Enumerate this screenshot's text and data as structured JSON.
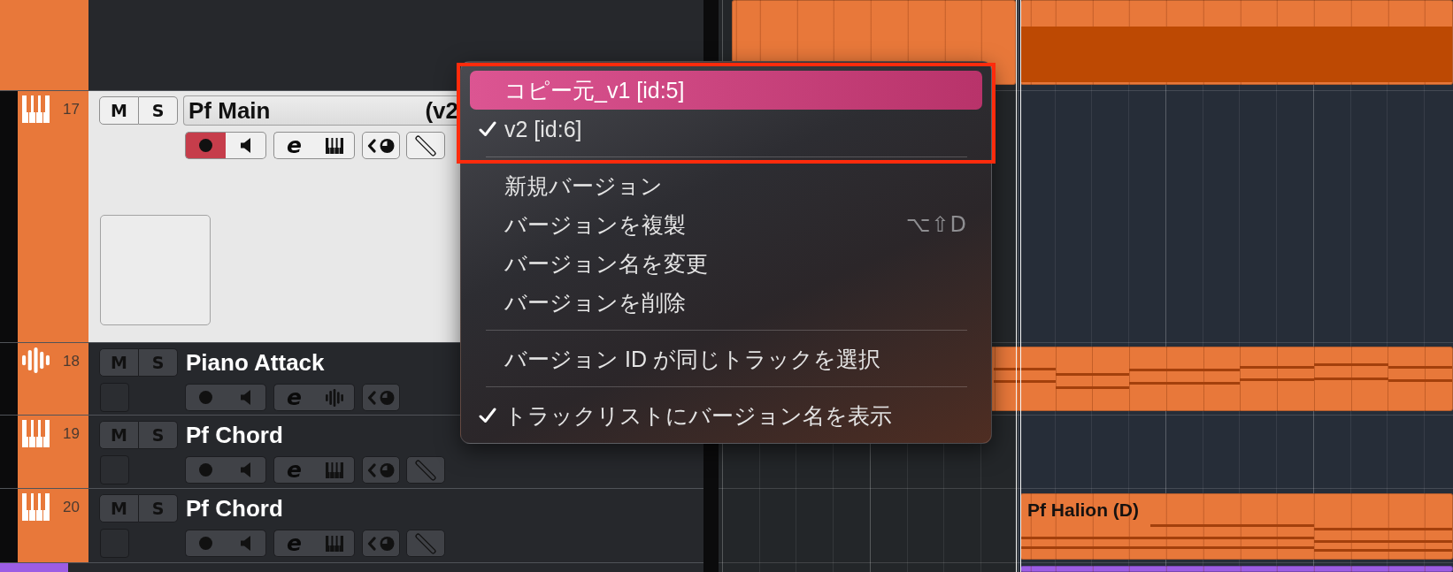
{
  "tracks": [
    {
      "kind": "folder",
      "color": "#e8783a",
      "selected": false,
      "events": [
        {
          "kind": "plain"
        },
        {
          "kind": "banded"
        }
      ],
      "children": [
        {
          "kind": "instrument",
          "number": "17",
          "color": "#e8783a",
          "selected": true,
          "mute": "M",
          "solo": "S",
          "name": "Pf Main",
          "version": "(v2",
          "record": true,
          "edit": "e"
        },
        {
          "kind": "audio",
          "number": "18",
          "color": "#e8783a",
          "selected": false,
          "mute": "M",
          "solo": "S",
          "name": "Piano Attack",
          "record": false,
          "edit": "e",
          "events": [
            {
              "kind": "notes"
            }
          ]
        },
        {
          "kind": "instrument",
          "number": "19",
          "color": "#e8783a",
          "selected": false,
          "mute": "M",
          "solo": "S",
          "name": "Pf Chord",
          "record": false,
          "edit": "e"
        },
        {
          "kind": "instrument",
          "number": "20",
          "color": "#e8783a",
          "selected": false,
          "mute": "M",
          "solo": "S",
          "name": "Pf Chord",
          "record": false,
          "edit": "e",
          "events": [
            {
              "kind": "notes",
              "label": "Pf Halion (D)"
            }
          ]
        }
      ]
    },
    {
      "color": "#9c5de4",
      "selected": false,
      "events": [
        {
          "kind": "plain"
        }
      ]
    }
  ],
  "context_menu": {
    "sections": [
      {
        "framed": true,
        "items": [
          {
            "label": "コピー元_v1 [id:5]",
            "selected": true,
            "checked": false
          },
          {
            "label": "v2 [id:6]",
            "selected": false,
            "checked": true
          }
        ]
      },
      {
        "framed": false,
        "items": [
          {
            "label": "新規バージョン",
            "selected": false,
            "checked": false
          },
          {
            "label": "バージョンを複製",
            "shortcut": "⌥⇧D",
            "selected": false,
            "checked": false
          },
          {
            "label": "バージョン名を変更",
            "selected": false,
            "checked": false
          },
          {
            "label": "バージョンを削除",
            "selected": false,
            "checked": false
          }
        ]
      },
      {
        "framed": false,
        "items": [
          {
            "label": "バージョン ID が同じトラックを選択",
            "selected": false,
            "checked": false
          }
        ]
      },
      {
        "framed": false,
        "items": [
          {
            "label": "トラックリストにバージョン名を表示",
            "selected": false,
            "checked": true
          }
        ]
      }
    ]
  }
}
